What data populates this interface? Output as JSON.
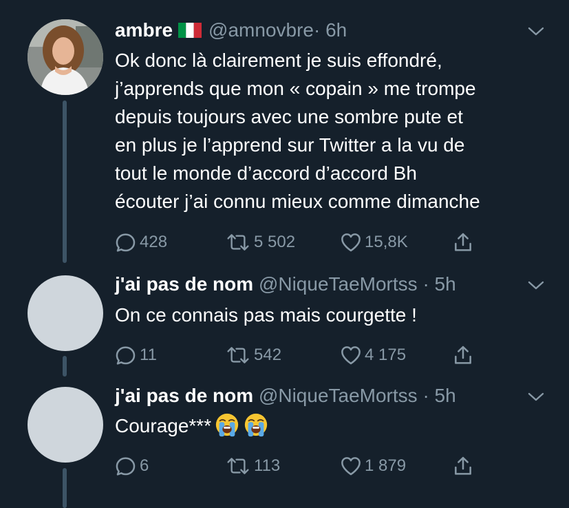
{
  "tweets": [
    {
      "name": "ambre",
      "flag_icon": "italy-flag-icon",
      "handle": "@amnovbre",
      "time": "· 6h",
      "text_lines": [
        "Ok donc là clairement je suis effondré,",
        "j’apprends que mon « copain » me trompe",
        "depuis toujours avec une sombre pute et",
        "en plus je l’apprend sur Twitter a la vu de",
        "tout le monde d’accord d’accord Bh",
        "écouter j’ai connu mieux comme dimanche"
      ],
      "replies": "428",
      "retweets": "5 502",
      "likes": "15,8K"
    },
    {
      "name": "j'ai pas de nom",
      "handle": "@NiqueTaeMortss",
      "time": "· 5h",
      "text": "On ce connais pas mais courgette !",
      "replies": "11",
      "retweets": "542",
      "likes": "4 175"
    },
    {
      "name": "j'ai pas de nom",
      "handle": "@NiqueTaeMortss",
      "time": "· 5h",
      "text": "Courage***",
      "emojis": [
        "loudly-crying-face-emoji",
        "loudly-crying-face-emoji"
      ],
      "replies": "6",
      "retweets": "113",
      "likes": "1 879"
    }
  ],
  "colors": {
    "background": "#15202b",
    "text": "#ffffff",
    "secondary": "#8899a6",
    "thread_line": "#3d5466",
    "avatar_placeholder": "#cfd6dc"
  }
}
